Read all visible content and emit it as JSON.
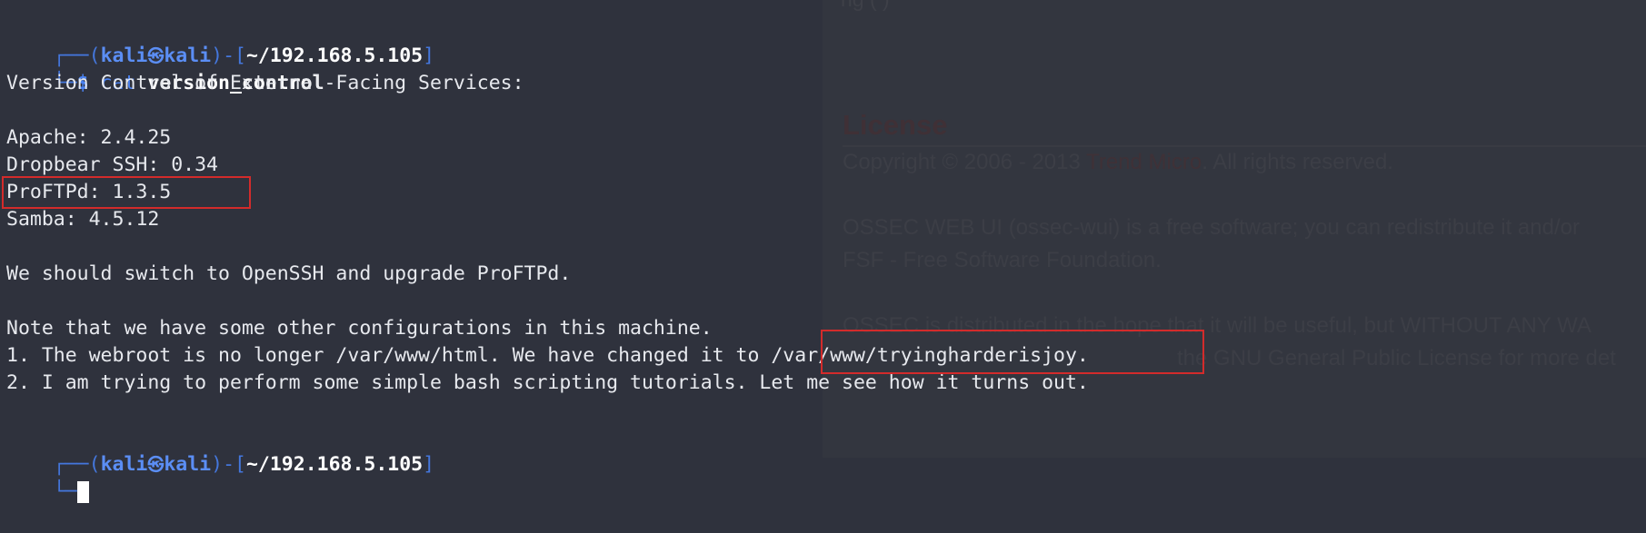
{
  "background_page": {
    "top_fragment": "ng       ( )",
    "license_heading": "License",
    "copyright_prefix": "Copyright © 2006 - 2013 ",
    "copyright_link": "Trend Micro",
    "copyright_suffix": ". All rights reserved.",
    "para1_line1": "OSSEC WEB UI (ossec-wui) is a free software; you can redistribute it and/or",
    "para1_line2": "FSF - Free Software Foundation.",
    "para2_line1": "OSSEC is distributed in the hope that it will be useful, but WITHOUT ANY WA",
    "para2_line2": "the GNU General Public License for more det"
  },
  "terminal": {
    "prompt1": {
      "corner": "┌──(",
      "user": "kali",
      "at": "㉿",
      "host": "kali",
      "mid": ")-[",
      "path": "~/192.168.5.105",
      "end": "]"
    },
    "command_line": {
      "corner": "└─",
      "dollar": "$",
      "cmd": "cat",
      "arg": "version_control"
    },
    "output_lines": [
      "Version Control of External-Facing Services:",
      "",
      "Apache: 2.4.25",
      "Dropbear SSH: 0.34",
      "ProFTPd: 1.3.5",
      "Samba: 4.5.12",
      "",
      "We should switch to OpenSSH and upgrade ProFTPd.",
      "",
      "Note that we have some other configurations in this machine.",
      "1. The webroot is no longer /var/www/html. We have changed it to /var/www/tryingharderisjoy.",
      "2. I am trying to perform some simple bash scripting tutorials. Let me see how it turns out."
    ],
    "prompt2": {
      "corner": "┌──(",
      "user": "kali",
      "at": "㉿",
      "host": "kali",
      "mid": ")-[",
      "path": "~/192.168.5.105",
      "end": "]"
    },
    "command_line2": {
      "corner": "└─"
    }
  },
  "colors": {
    "terminal_bg": "#2f323d",
    "prompt_blue": "#5b8ef5",
    "highlight_red": "#d32b2b"
  }
}
